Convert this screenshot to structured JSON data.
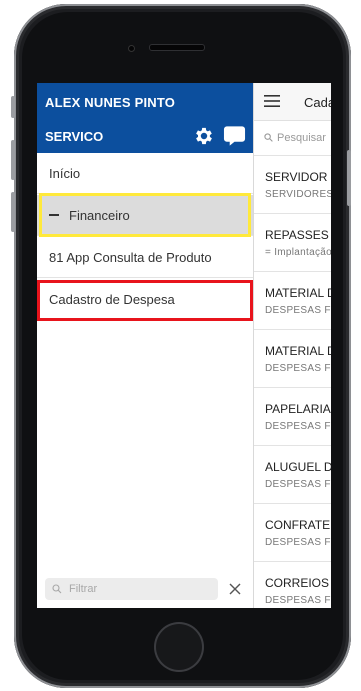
{
  "drawer": {
    "user_name": "ALEX NUNES PINTO",
    "company": "SERVICO",
    "settings_icon": "gear-icon",
    "chat_icon": "chat-bubble-icon",
    "menu": [
      {
        "label": "Início"
      },
      {
        "label": "Financeiro",
        "expanded": true,
        "icon": "minus-icon"
      },
      {
        "label": "81 App Consulta de Produto"
      },
      {
        "label": "Cadastro de Despesa"
      }
    ],
    "filter": {
      "placeholder": "Filtrar"
    }
  },
  "main": {
    "title": "Cada",
    "search_placeholder": "Pesquisar",
    "items": [
      {
        "title": "SERVIDOR",
        "subtitle": "SERVIDORES"
      },
      {
        "title": "REPASSES",
        "subtitle": "= Implantação"
      },
      {
        "title": "MATERIAL D",
        "subtitle": "DESPESAS F"
      },
      {
        "title": "MATERIAL D",
        "subtitle": "DESPESAS F"
      },
      {
        "title": "PAPELARIA",
        "subtitle": "DESPESAS F"
      },
      {
        "title": "ALUGUEL D",
        "subtitle": "DESPESAS F"
      },
      {
        "title": "CONFRATE",
        "subtitle": "DESPESAS F"
      },
      {
        "title": "CORREIOS",
        "subtitle": "DESPESAS F"
      }
    ]
  },
  "colors": {
    "header_blue": "#0c4f9e",
    "highlight_yellow": "#ffe93b",
    "highlight_red": "#e8141c"
  }
}
